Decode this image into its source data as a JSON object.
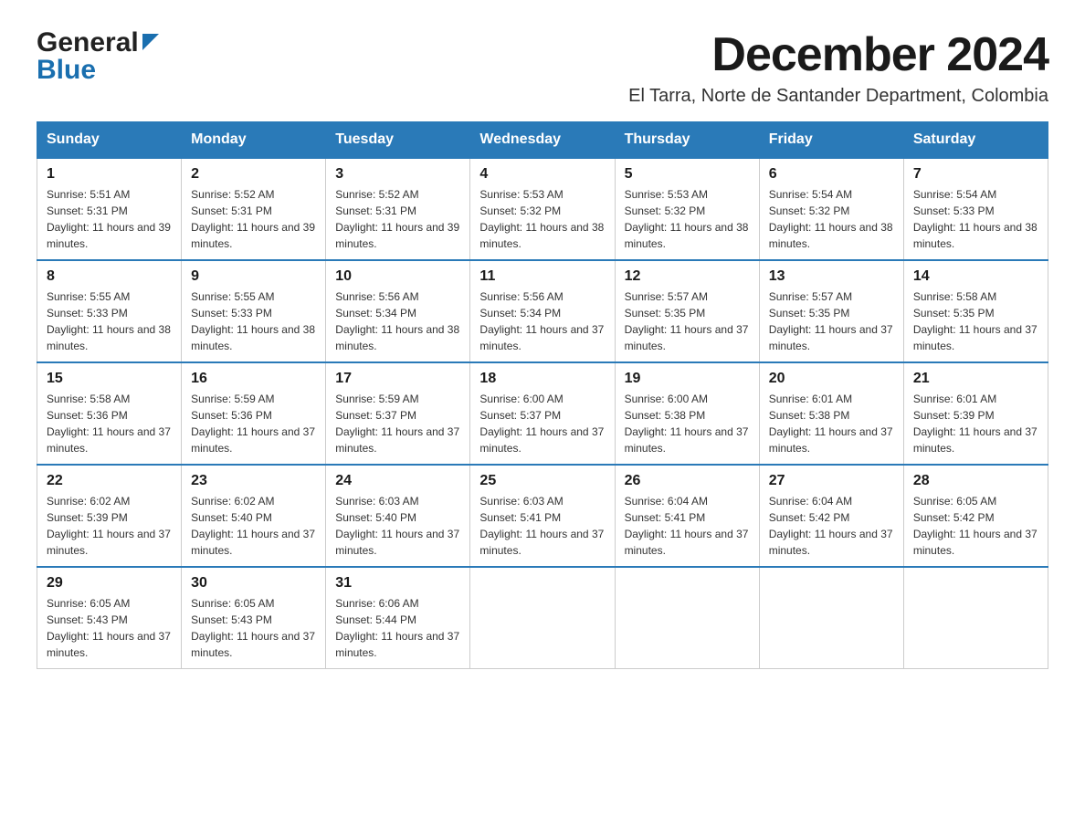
{
  "logo": {
    "general": "General",
    "blue": "Blue"
  },
  "header": {
    "month_year": "December 2024",
    "location": "El Tarra, Norte de Santander Department, Colombia"
  },
  "days_of_week": [
    "Sunday",
    "Monday",
    "Tuesday",
    "Wednesday",
    "Thursday",
    "Friday",
    "Saturday"
  ],
  "weeks": [
    [
      {
        "day": "1",
        "sunrise": "Sunrise: 5:51 AM",
        "sunset": "Sunset: 5:31 PM",
        "daylight": "Daylight: 11 hours and 39 minutes."
      },
      {
        "day": "2",
        "sunrise": "Sunrise: 5:52 AM",
        "sunset": "Sunset: 5:31 PM",
        "daylight": "Daylight: 11 hours and 39 minutes."
      },
      {
        "day": "3",
        "sunrise": "Sunrise: 5:52 AM",
        "sunset": "Sunset: 5:31 PM",
        "daylight": "Daylight: 11 hours and 39 minutes."
      },
      {
        "day": "4",
        "sunrise": "Sunrise: 5:53 AM",
        "sunset": "Sunset: 5:32 PM",
        "daylight": "Daylight: 11 hours and 38 minutes."
      },
      {
        "day": "5",
        "sunrise": "Sunrise: 5:53 AM",
        "sunset": "Sunset: 5:32 PM",
        "daylight": "Daylight: 11 hours and 38 minutes."
      },
      {
        "day": "6",
        "sunrise": "Sunrise: 5:54 AM",
        "sunset": "Sunset: 5:32 PM",
        "daylight": "Daylight: 11 hours and 38 minutes."
      },
      {
        "day": "7",
        "sunrise": "Sunrise: 5:54 AM",
        "sunset": "Sunset: 5:33 PM",
        "daylight": "Daylight: 11 hours and 38 minutes."
      }
    ],
    [
      {
        "day": "8",
        "sunrise": "Sunrise: 5:55 AM",
        "sunset": "Sunset: 5:33 PM",
        "daylight": "Daylight: 11 hours and 38 minutes."
      },
      {
        "day": "9",
        "sunrise": "Sunrise: 5:55 AM",
        "sunset": "Sunset: 5:33 PM",
        "daylight": "Daylight: 11 hours and 38 minutes."
      },
      {
        "day": "10",
        "sunrise": "Sunrise: 5:56 AM",
        "sunset": "Sunset: 5:34 PM",
        "daylight": "Daylight: 11 hours and 38 minutes."
      },
      {
        "day": "11",
        "sunrise": "Sunrise: 5:56 AM",
        "sunset": "Sunset: 5:34 PM",
        "daylight": "Daylight: 11 hours and 37 minutes."
      },
      {
        "day": "12",
        "sunrise": "Sunrise: 5:57 AM",
        "sunset": "Sunset: 5:35 PM",
        "daylight": "Daylight: 11 hours and 37 minutes."
      },
      {
        "day": "13",
        "sunrise": "Sunrise: 5:57 AM",
        "sunset": "Sunset: 5:35 PM",
        "daylight": "Daylight: 11 hours and 37 minutes."
      },
      {
        "day": "14",
        "sunrise": "Sunrise: 5:58 AM",
        "sunset": "Sunset: 5:35 PM",
        "daylight": "Daylight: 11 hours and 37 minutes."
      }
    ],
    [
      {
        "day": "15",
        "sunrise": "Sunrise: 5:58 AM",
        "sunset": "Sunset: 5:36 PM",
        "daylight": "Daylight: 11 hours and 37 minutes."
      },
      {
        "day": "16",
        "sunrise": "Sunrise: 5:59 AM",
        "sunset": "Sunset: 5:36 PM",
        "daylight": "Daylight: 11 hours and 37 minutes."
      },
      {
        "day": "17",
        "sunrise": "Sunrise: 5:59 AM",
        "sunset": "Sunset: 5:37 PM",
        "daylight": "Daylight: 11 hours and 37 minutes."
      },
      {
        "day": "18",
        "sunrise": "Sunrise: 6:00 AM",
        "sunset": "Sunset: 5:37 PM",
        "daylight": "Daylight: 11 hours and 37 minutes."
      },
      {
        "day": "19",
        "sunrise": "Sunrise: 6:00 AM",
        "sunset": "Sunset: 5:38 PM",
        "daylight": "Daylight: 11 hours and 37 minutes."
      },
      {
        "day": "20",
        "sunrise": "Sunrise: 6:01 AM",
        "sunset": "Sunset: 5:38 PM",
        "daylight": "Daylight: 11 hours and 37 minutes."
      },
      {
        "day": "21",
        "sunrise": "Sunrise: 6:01 AM",
        "sunset": "Sunset: 5:39 PM",
        "daylight": "Daylight: 11 hours and 37 minutes."
      }
    ],
    [
      {
        "day": "22",
        "sunrise": "Sunrise: 6:02 AM",
        "sunset": "Sunset: 5:39 PM",
        "daylight": "Daylight: 11 hours and 37 minutes."
      },
      {
        "day": "23",
        "sunrise": "Sunrise: 6:02 AM",
        "sunset": "Sunset: 5:40 PM",
        "daylight": "Daylight: 11 hours and 37 minutes."
      },
      {
        "day": "24",
        "sunrise": "Sunrise: 6:03 AM",
        "sunset": "Sunset: 5:40 PM",
        "daylight": "Daylight: 11 hours and 37 minutes."
      },
      {
        "day": "25",
        "sunrise": "Sunrise: 6:03 AM",
        "sunset": "Sunset: 5:41 PM",
        "daylight": "Daylight: 11 hours and 37 minutes."
      },
      {
        "day": "26",
        "sunrise": "Sunrise: 6:04 AM",
        "sunset": "Sunset: 5:41 PM",
        "daylight": "Daylight: 11 hours and 37 minutes."
      },
      {
        "day": "27",
        "sunrise": "Sunrise: 6:04 AM",
        "sunset": "Sunset: 5:42 PM",
        "daylight": "Daylight: 11 hours and 37 minutes."
      },
      {
        "day": "28",
        "sunrise": "Sunrise: 6:05 AM",
        "sunset": "Sunset: 5:42 PM",
        "daylight": "Daylight: 11 hours and 37 minutes."
      }
    ],
    [
      {
        "day": "29",
        "sunrise": "Sunrise: 6:05 AM",
        "sunset": "Sunset: 5:43 PM",
        "daylight": "Daylight: 11 hours and 37 minutes."
      },
      {
        "day": "30",
        "sunrise": "Sunrise: 6:05 AM",
        "sunset": "Sunset: 5:43 PM",
        "daylight": "Daylight: 11 hours and 37 minutes."
      },
      {
        "day": "31",
        "sunrise": "Sunrise: 6:06 AM",
        "sunset": "Sunset: 5:44 PM",
        "daylight": "Daylight: 11 hours and 37 minutes."
      },
      null,
      null,
      null,
      null
    ]
  ]
}
